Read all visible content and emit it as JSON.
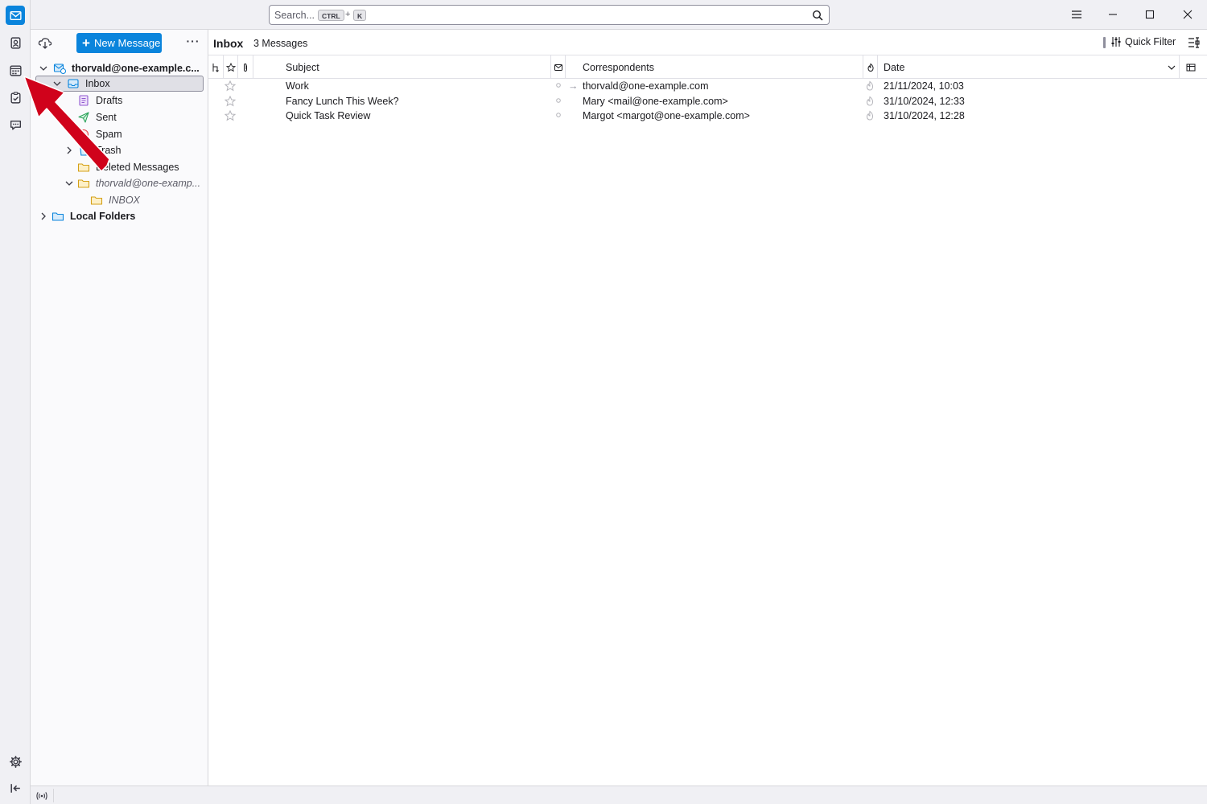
{
  "app": {
    "accent_color": "#0a84dc"
  },
  "search": {
    "placeholder": "Search...",
    "kbd_ctrl": "CTRL",
    "kbd_plus": "+",
    "kbd_key": "K"
  },
  "spaces": [
    "mail-icon",
    "address-book-icon",
    "calendar-icon",
    "tasks-icon",
    "chat-icon",
    "settings-icon",
    "collapse-icon"
  ],
  "folder_pane": {
    "new_message_label": "New Message",
    "more_label": "···",
    "account": "thorvald@one-example.c...",
    "folders": {
      "inbox": "Inbox",
      "drafts": "Drafts",
      "sent": "Sent",
      "spam": "Spam",
      "trash": "Trash",
      "deleted": "Deleted Messages",
      "sub_account": "thorvald@one-examp...",
      "sub_inbox": "INBOX",
      "local": "Local Folders"
    }
  },
  "thread_pane": {
    "folder_name": "Inbox",
    "message_count": "3 Messages",
    "quick_filter_label": "Quick Filter",
    "columns": {
      "subject": "Subject",
      "correspondents": "Correspondents",
      "date": "Date"
    },
    "messages": [
      {
        "subject": "Work",
        "correspondent": "thorvald@one-example.com",
        "date": "21/11/2024, 10:03",
        "outgoing": true
      },
      {
        "subject": "Fancy Lunch This Week?",
        "correspondent": "Mary <mail@one-example.com>",
        "date": "31/10/2024, 12:33",
        "outgoing": false
      },
      {
        "subject": "Quick Task Review",
        "correspondent": "Margot <margot@one-example.com>",
        "date": "31/10/2024, 12:28",
        "outgoing": false
      }
    ]
  },
  "annotation": {
    "arrow_color": "#d0021b",
    "points_to": "calendar-icon"
  }
}
